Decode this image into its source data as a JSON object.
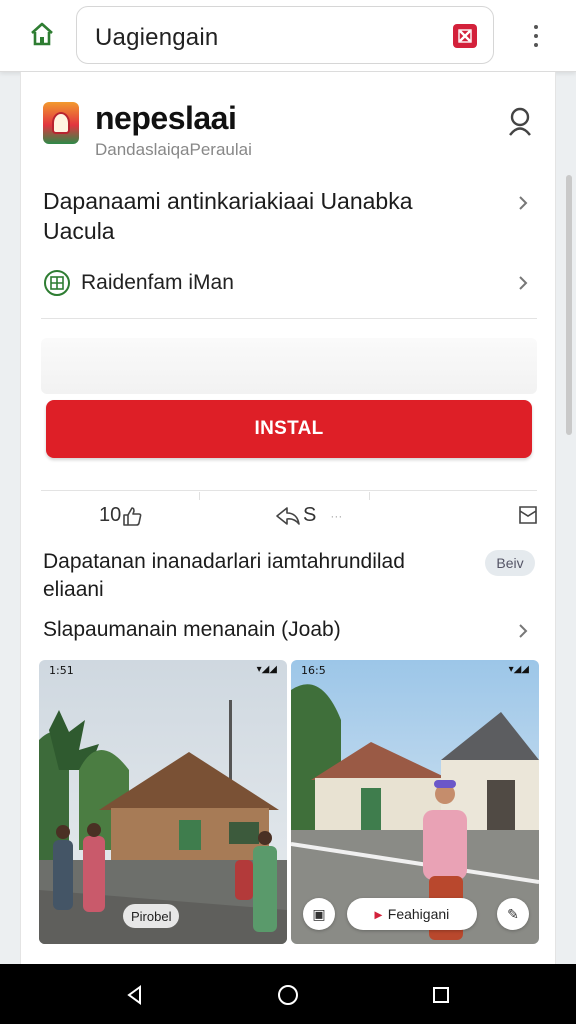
{
  "browser": {
    "url": "Uagiengain",
    "home_icon": "home-icon",
    "menu_icon": "more-vert-icon",
    "accent": "#2e7d32"
  },
  "app": {
    "name": "nepeslaai",
    "developer": "DandaslaiqaPeraulai",
    "title": "Dapanaami antinkariakiaai Uanabka Uacula",
    "gov_label": "Raidenfam iMan",
    "install_label": "INSTAL",
    "brand_color": "#de1f27"
  },
  "stats": {
    "likes": "10",
    "shares": "S",
    "more": "···"
  },
  "description": {
    "text": "Dapatanan inanadarlari iamtahrundilad eliaani",
    "badge": "Beiv",
    "screenshots_heading": "Slapaumanain menanain (Joab)"
  },
  "screenshots": [
    {
      "time": "1:51",
      "status_right": "▾◢◢",
      "caption": "Pirobel"
    },
    {
      "time": "16:5",
      "status_right": "▾◢◢",
      "caption": "Feahigani"
    }
  ]
}
